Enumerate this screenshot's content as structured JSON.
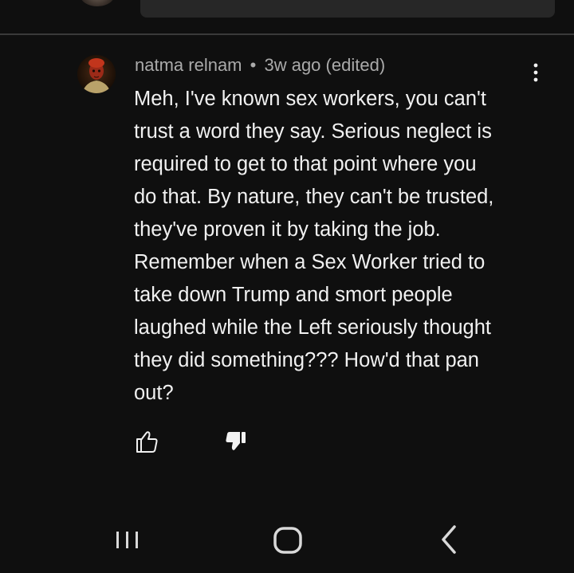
{
  "comment": {
    "author": "natma relnam",
    "separator": "•",
    "timestamp": "3w ago",
    "edited_label": "(edited)",
    "text": "Meh, I've known sex workers, you can't\ntrust a word they say. Serious neglect is\nrequired to get to that point where you\ndo that. By nature, they can't be trusted,\nthey've proven it by taking the job.\nRemember when a Sex Worker tried to\ntake down Trump and smort people\nlaughed while the Left seriously thought\nthey did something??? How'd that pan\nout?",
    "dislike_active": true
  },
  "icons": {
    "more": "more-vert-icon",
    "like": "thumbs-up-outline-icon",
    "dislike": "thumbs-down-filled-icon",
    "nav_recent": "recent-apps-icon",
    "nav_home": "home-icon",
    "nav_back": "back-chevron-icon"
  },
  "colors": {
    "background": "#0f0f0f",
    "text_primary": "#f1f1f1",
    "text_secondary": "#aaaaaa",
    "divider": "#3a3a3a",
    "input_bg": "#272727"
  }
}
